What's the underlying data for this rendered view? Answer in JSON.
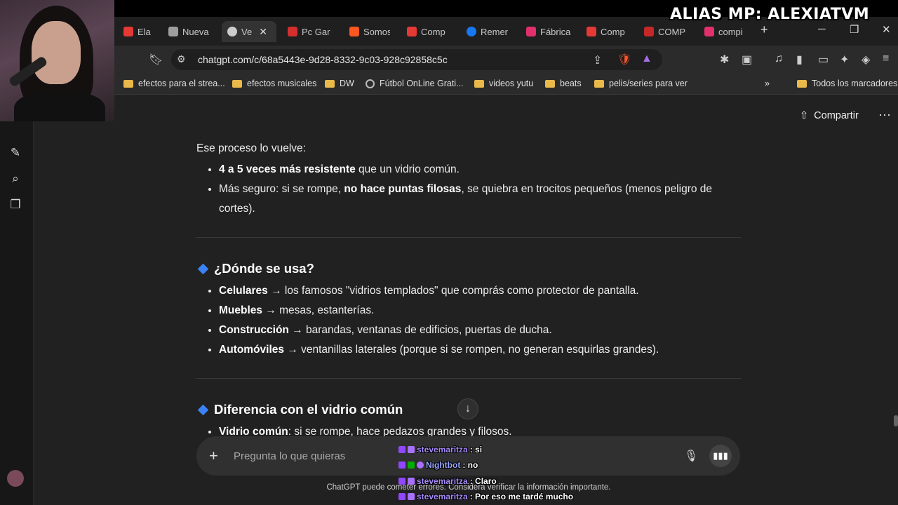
{
  "overlay": {
    "alias": "ALIAS MP: ALEXIATVM"
  },
  "browser": {
    "tabs": [
      {
        "label": "Ela",
        "color": "#e53935"
      },
      {
        "label": "Nueva",
        "color": "#9e9e9e"
      },
      {
        "label": "Ve",
        "color": "#cccccc",
        "active": true
      },
      {
        "label": "Pc Gar",
        "color": "#d32f2f"
      },
      {
        "label": "Somos",
        "color": "#ff5722"
      },
      {
        "label": "Comp",
        "color": "#e53935"
      },
      {
        "label": "Remer",
        "color": "#1877f2"
      },
      {
        "label": "Fábrica",
        "color": "#e1306c"
      },
      {
        "label": "Comp",
        "color": "#e53935"
      },
      {
        "label": "COMP",
        "color": "#c62828"
      },
      {
        "label": "compi",
        "color": "#e1306c"
      }
    ],
    "url": "chatgpt.com/c/68a5443e-9d28-8332-9c03-928c92858c5c",
    "bookmarks": [
      {
        "label": "efectos para el strea...",
        "type": "folder"
      },
      {
        "label": "efectos musicales",
        "type": "folder"
      },
      {
        "label": "DW",
        "type": "folder"
      },
      {
        "label": "Fútbol OnLine Grati...",
        "type": "globe"
      },
      {
        "label": "videos yutu",
        "type": "folder"
      },
      {
        "label": "beats",
        "type": "folder"
      },
      {
        "label": "pelis/series para ver",
        "type": "folder"
      }
    ],
    "all_bookmarks": "Todos los marcadores"
  },
  "header": {
    "share_label": "Compartir"
  },
  "content": {
    "intro": "Ese proceso lo vuelve:",
    "list1": [
      {
        "bold": "4 a 5 veces más resistente",
        "rest": " que un vidrio común."
      },
      {
        "pre": "Más seguro: si se rompe, ",
        "bold": "no hace puntas filosas",
        "rest": ", se quiebra en trocitos pequeños (menos peligro de cortes)."
      }
    ],
    "h_uses": "¿Dónde se usa?",
    "uses": [
      {
        "bold": "Celulares",
        "rest": " → los famosos \"vidrios templados\" que comprás como protector de pantalla."
      },
      {
        "bold": "Muebles",
        "rest": " → mesas, estanterías."
      },
      {
        "bold": "Construcción",
        "rest": " → barandas, ventanas de edificios, puertas de ducha."
      },
      {
        "bold": "Automóviles",
        "rest": " → ventanillas laterales (porque si se rompen, no generan esquirlas grandes)."
      }
    ],
    "h_diff": "Diferencia con el vidrio común",
    "diff": [
      {
        "bold": "Vidrio común",
        "rest": ": si se rompe, hace pedazos grandes y filosos."
      }
    ]
  },
  "composer": {
    "placeholder": "Pregunta lo que quieras"
  },
  "disclaimer": "ChatGPT puede cometer errores. Considera verificar la información importante.",
  "chat": [
    {
      "user": "stevemaritza",
      "msg": " : si"
    },
    {
      "user": "Nightbot",
      "msg": " : no"
    },
    {
      "user": "stevemaritza",
      "msg": " : Claro"
    },
    {
      "user": "stevemaritza",
      "msg": " : Por eso me tardé mucho"
    }
  ]
}
